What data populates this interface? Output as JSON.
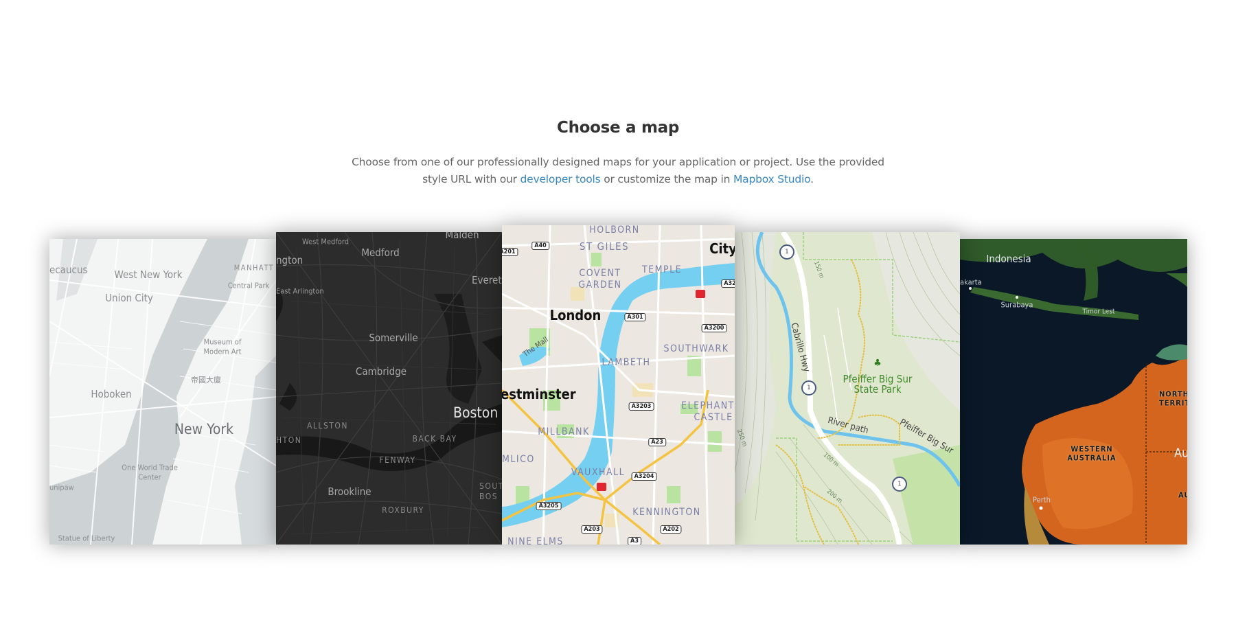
{
  "header": {
    "title": "Choose a map",
    "description_part1": "Choose from one of our professionally designed maps for your application or project. Use the provided style URL with our ",
    "link_developer_tools": "developer tools",
    "description_part2": " or customize the map in ",
    "link_mapbox_studio": "Mapbox Studio",
    "description_end": "."
  },
  "maps": [
    {
      "labels": [
        "ecaucus",
        "West New York",
        "Union City",
        "MANHATT",
        "Central Park",
        "Museum of",
        "Modern Art",
        "帝國大廈",
        "Hoboken",
        "New York",
        "One World Trade",
        "Center",
        "Statue of Liberty",
        "unipaw"
      ]
    },
    {
      "labels": [
        "West Medford",
        "Malden",
        "Medford",
        "ngton",
        "Everett",
        "East Arlington",
        "Somerville",
        "Cambridge",
        "Boston",
        "ALLSTON",
        "HTON",
        "BACK BAY",
        "FENWAY",
        "Brookline",
        "SOUTH",
        "BOS",
        "ROXBURY"
      ]
    },
    {
      "labels": [
        "HOLBORN",
        "ST GILES",
        "City",
        "COVENT",
        "GARDEN",
        "TEMPLE",
        "London",
        "The Mall",
        "LAMBETH",
        "SOUTHWARK",
        "estminster",
        "ELEPHANT",
        "CASTLE",
        "MILLBANK",
        "MLICO",
        "VAUXHALL",
        "KENNINGTON",
        "NINE ELMS"
      ],
      "road_shields": [
        "A40",
        "A201",
        "A301",
        "A3200",
        "A3203",
        "A23",
        "A3204",
        "A3205",
        "A203",
        "A202",
        "A3",
        "A32"
      ]
    },
    {
      "labels": [
        "Cabrillo Hwy",
        "Pfeiffer Big Sur",
        "State Park",
        "River path",
        "Pfeiffer Big Sur",
        "150 m",
        "100 m",
        "200 m",
        "250 m"
      ],
      "route_shield": "1"
    },
    {
      "labels": [
        "Indonesia",
        "akarta",
        "Surabaya",
        "Timor Lest",
        "NORTH",
        "TERRIT",
        "WESTERN",
        "AUSTRALIA",
        "Aus",
        "AU",
        "Perth"
      ]
    }
  ]
}
